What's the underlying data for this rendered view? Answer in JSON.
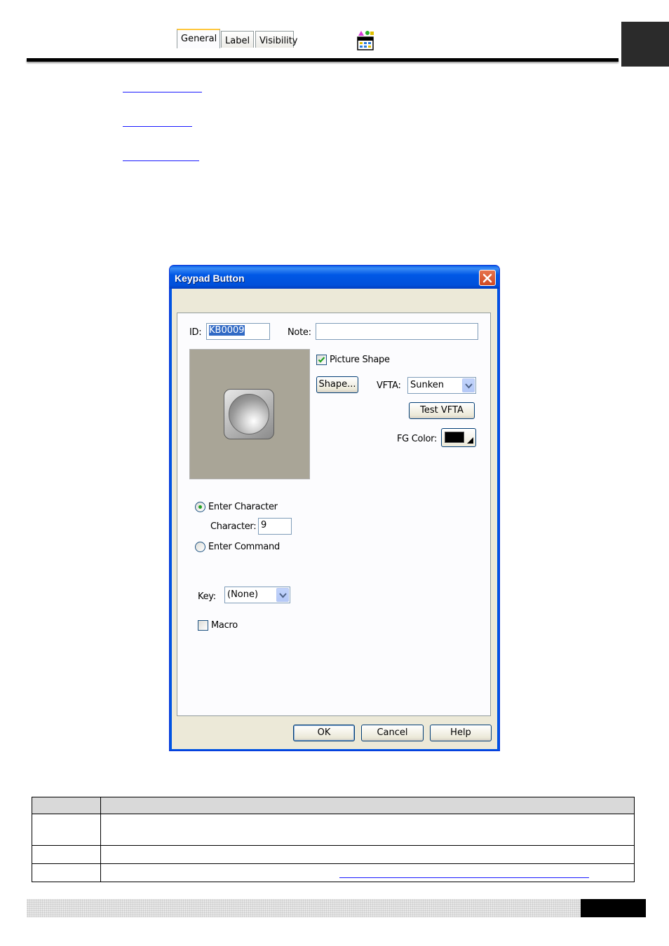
{
  "dialog": {
    "title": "Keypad Button",
    "tabs": [
      {
        "label": "General",
        "active": true
      },
      {
        "label": "Label",
        "active": false
      },
      {
        "label": "Visibility",
        "active": false
      }
    ],
    "general": {
      "id_label": "ID:",
      "id_value": "KB0009",
      "note_label": "Note:",
      "note_value": "",
      "picture_shape_label": "Picture Shape",
      "picture_shape_checked": true,
      "shape_button": "Shape...",
      "vfta_label": "VFTA:",
      "vfta_value": "Sunken",
      "test_vfta_button": "Test VFTA",
      "fg_color_label": "FG Color:",
      "fg_color_value": "#000000",
      "enter_character_label": "Enter Character",
      "enter_character_selected": true,
      "character_label": "Character:",
      "character_value": "9",
      "enter_command_label": "Enter Command",
      "enter_command_selected": false,
      "key_label": "Key:",
      "key_value": "(None)",
      "macro_label": "Macro",
      "macro_checked": false
    },
    "buttons": {
      "ok": "OK",
      "cancel": "Cancel",
      "help": "Help"
    }
  },
  "icons": {
    "header": "screen-designer-icon",
    "close": "close-x-icon",
    "dropdown": "chevron-down-icon",
    "check": "checkmark-icon"
  },
  "colors": {
    "title_bar": "#0054e3",
    "dialog_face": "#ece9d8",
    "preview_bg": "#a9a597",
    "link": "#1a1aff"
  }
}
